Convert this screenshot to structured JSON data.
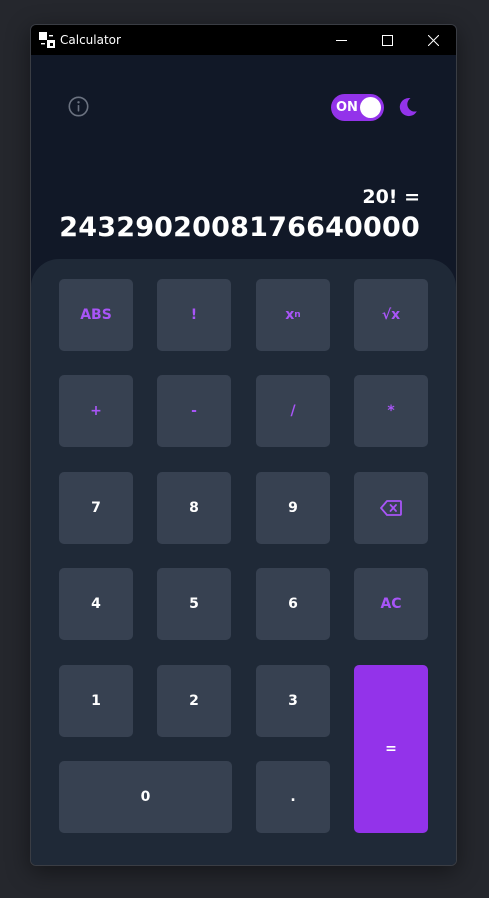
{
  "window": {
    "title": "Calculator"
  },
  "header": {
    "toggle_label": "ON",
    "toggle_on": true,
    "accent_color": "#9333ea"
  },
  "icons": {
    "info": "info-circle-icon",
    "theme": "moon-icon",
    "backspace": "backspace-icon"
  },
  "display": {
    "expression": "20! =",
    "result": "2432902008176640000"
  },
  "keys": {
    "abs": "ABS",
    "factorial": "!",
    "power_base": "x",
    "power_exp": "n",
    "sqrt": "√x",
    "plus": "+",
    "minus": "-",
    "divide": "/",
    "multiply": "*",
    "seven": "7",
    "eight": "8",
    "nine": "9",
    "four": "4",
    "five": "5",
    "six": "6",
    "clear": "AC",
    "one": "1",
    "two": "2",
    "three": "3",
    "zero": "0",
    "decimal": ".",
    "equals": "="
  }
}
